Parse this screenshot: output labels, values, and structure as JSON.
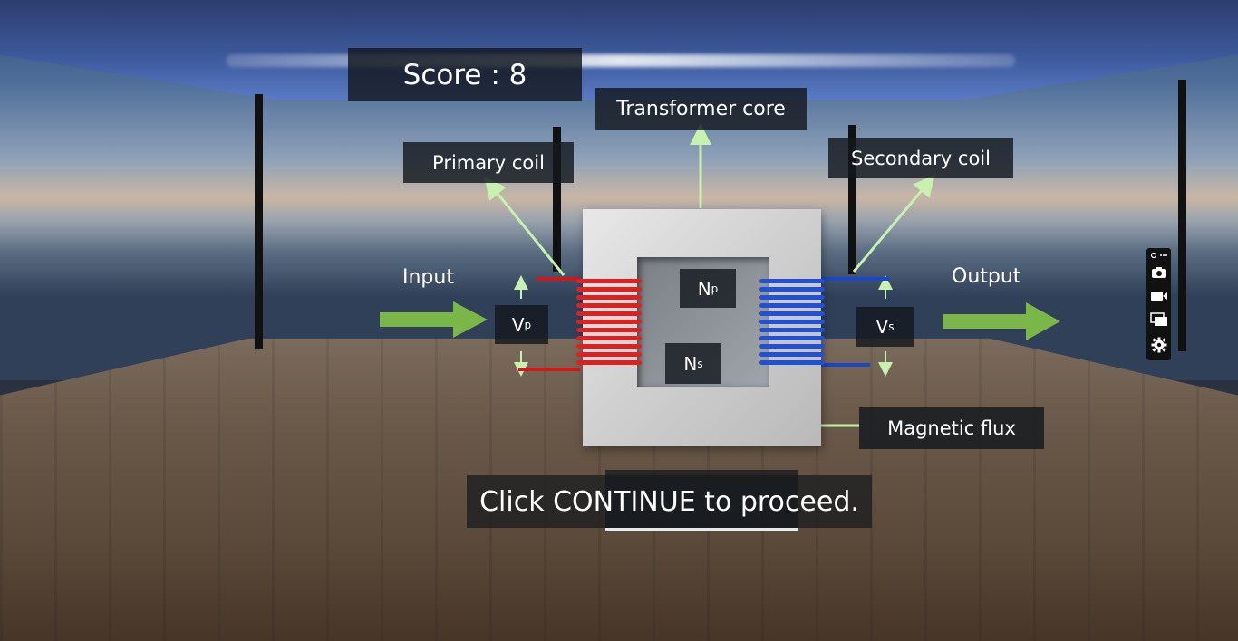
{
  "score": {
    "label": "Score : 8"
  },
  "labels": {
    "transformer_core": "Transformer core",
    "primary_coil": "Primary coil",
    "secondary_coil": "Secondary coil",
    "magnetic_flux": "Magnetic flux",
    "input": "Input",
    "output": "Output",
    "vp_main": "V",
    "vp_sub": "p",
    "vs_main": "V",
    "vs_sub": "s",
    "np_main": "N",
    "np_sub": "p",
    "ns_main": "N",
    "ns_sub": "s"
  },
  "instruction": "Click CONTINUE to proceed.",
  "colors": {
    "primary_coil": "#e02020",
    "secondary_coil": "#2050d8",
    "arrow_green": "#7ab648",
    "pointer": "#c8f0b0"
  },
  "toolbar": {
    "icons": [
      "link-more-icon",
      "camera-icon",
      "video-icon",
      "windows-icon",
      "gear-icon"
    ]
  }
}
